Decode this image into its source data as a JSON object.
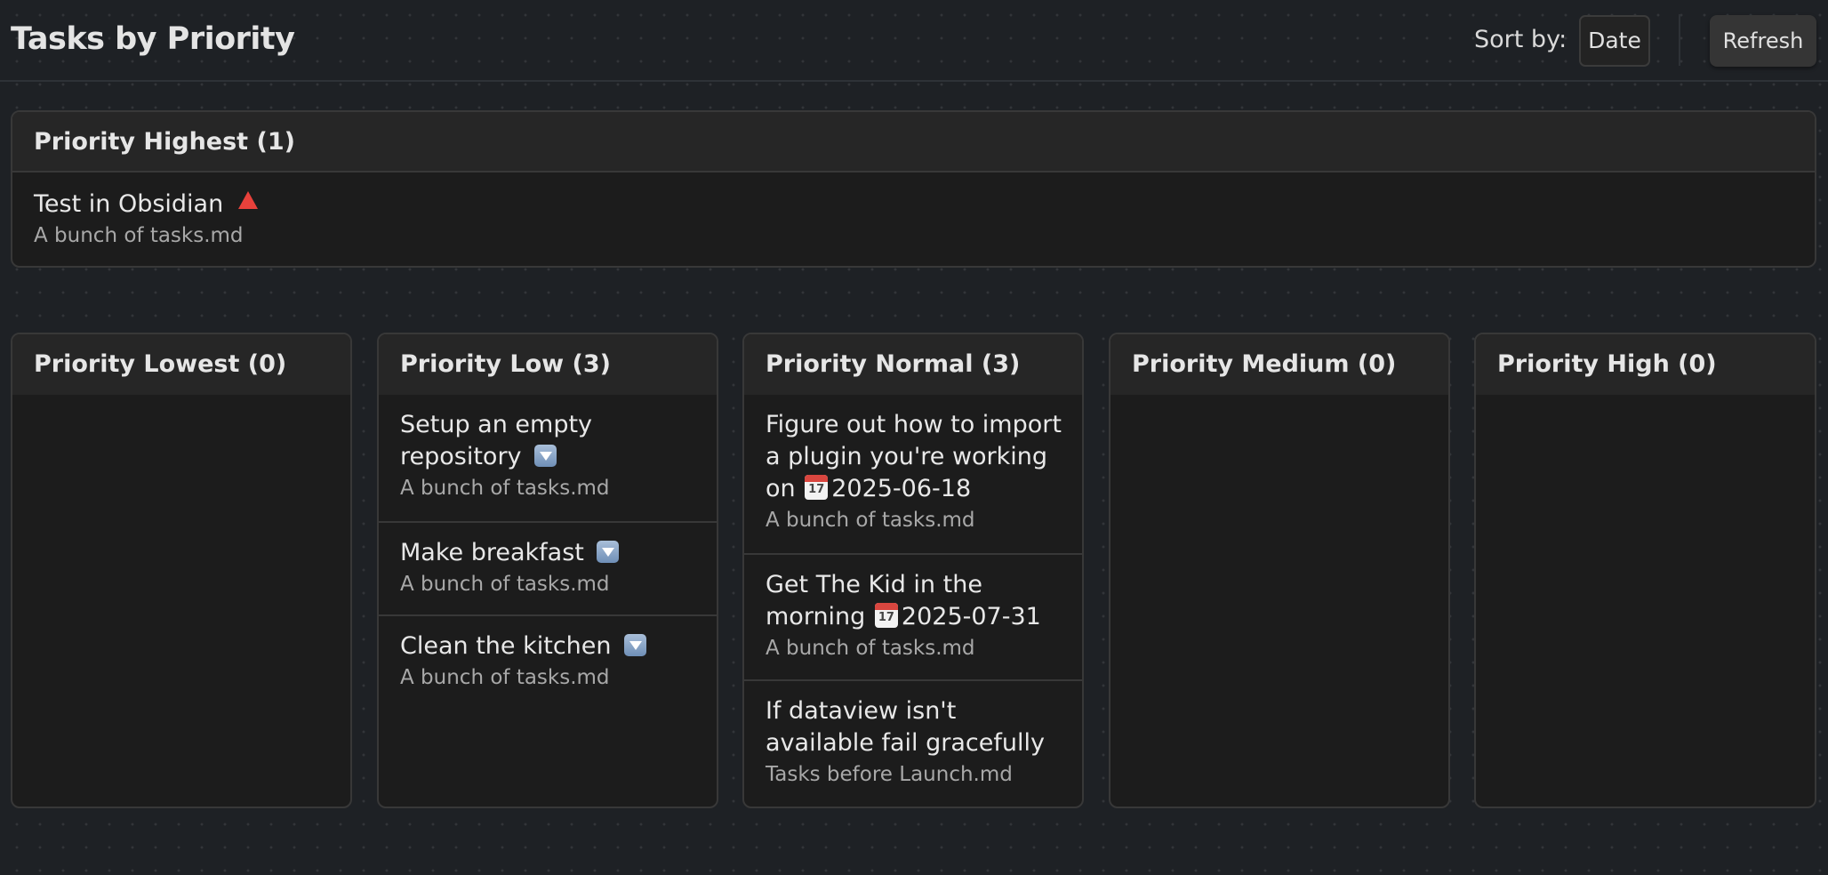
{
  "header": {
    "title": "Tasks by Priority",
    "sort_label": "Sort by:",
    "sort_value": "Date",
    "refresh_label": "Refresh"
  },
  "highest": {
    "title": "Priority Highest (1)",
    "tasks": [
      {
        "title": "Test in Obsidian",
        "file": "A bunch of tasks.md",
        "icon": "red-triangle-up-icon"
      }
    ]
  },
  "columns": [
    {
      "title": "Priority Lowest (0)",
      "tasks": []
    },
    {
      "title": "Priority Low (3)",
      "tasks": [
        {
          "title": "Setup an empty repository",
          "file": "A bunch of tasks.md",
          "icon": "down-arrow-button-icon"
        },
        {
          "title": "Make breakfast",
          "file": "A bunch of tasks.md",
          "icon": "down-arrow-button-icon"
        },
        {
          "title": "Clean the kitchen",
          "file": "A bunch of tasks.md",
          "icon": "down-arrow-button-icon"
        }
      ]
    },
    {
      "title": "Priority Normal (3)",
      "tasks": [
        {
          "title_before": "Figure out how to import a plugin you're working on",
          "date": "2025-06-18",
          "file": "A bunch of tasks.md",
          "icon": "calendar-icon"
        },
        {
          "title_before": "Get The Kid in the morning",
          "date": "2025-07-31",
          "file": "A bunch of tasks.md",
          "icon": "calendar-icon"
        },
        {
          "title": "If dataview isn't available fail gracefully",
          "file": "Tasks before Launch.md"
        }
      ]
    },
    {
      "title": "Priority Medium (0)",
      "tasks": []
    },
    {
      "title": "Priority High (0)",
      "tasks": []
    }
  ],
  "colors": {
    "background": "#1e2125",
    "card": "#1c1c1c",
    "card_header": "#262626",
    "border": "#383838",
    "text": "#e8e8e8",
    "muted": "#a8a8a8",
    "priority_highest_icon": "#e8413b",
    "priority_low_icon": "#8aa6c9"
  }
}
